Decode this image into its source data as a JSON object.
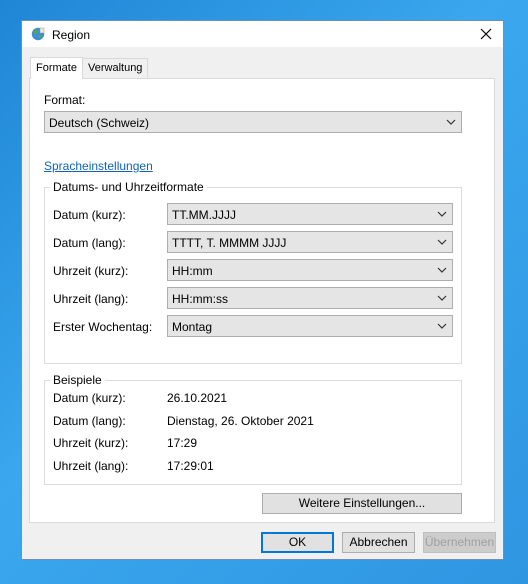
{
  "window": {
    "title": "Region",
    "icon": "globe-icon"
  },
  "tabs": [
    {
      "label": "Formate",
      "active": true
    },
    {
      "label": "Verwaltung",
      "active": false
    }
  ],
  "format": {
    "label": "Format:",
    "value": "Deutsch (Schweiz)"
  },
  "language_link": "Spracheinstellungen",
  "date_time_formats": {
    "legend": "Datums- und Uhrzeitformate",
    "rows": [
      {
        "label": "Datum (kurz):",
        "value": "TT.MM.JJJJ"
      },
      {
        "label": "Datum (lang):",
        "value": "TTTT, T. MMMM JJJJ"
      },
      {
        "label": "Uhrzeit (kurz):",
        "value": "HH:mm"
      },
      {
        "label": "Uhrzeit (lang):",
        "value": "HH:mm:ss"
      },
      {
        "label": "Erster Wochentag:",
        "value": "Montag"
      }
    ]
  },
  "examples": {
    "legend": "Beispiele",
    "rows": [
      {
        "label": "Datum (kurz):",
        "value": "26.10.2021"
      },
      {
        "label": "Datum (lang):",
        "value": "Dienstag, 26. Oktober 2021"
      },
      {
        "label": "Uhrzeit (kurz):",
        "value": "17:29"
      },
      {
        "label": "Uhrzeit (lang):",
        "value": "17:29:01"
      }
    ]
  },
  "buttons": {
    "more_settings": "Weitere Einstellungen...",
    "ok": "OK",
    "cancel": "Abbrechen",
    "apply": "Übernehmen"
  },
  "colors": {
    "accent": "#0078d7",
    "link": "#0f64b8",
    "desktop": "#2f96e2"
  }
}
